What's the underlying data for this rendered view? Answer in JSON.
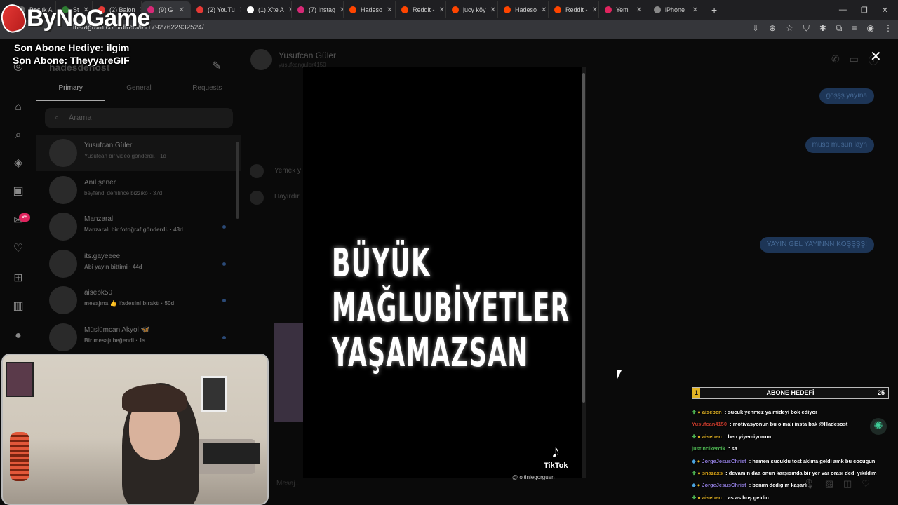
{
  "browser": {
    "tabs": [
      {
        "title": "Başlık A",
        "color": "#666"
      },
      {
        "title": "St",
        "color": "#2e7d32"
      },
      {
        "title": "(2) Balon",
        "color": "#e53935"
      },
      {
        "title": "(9) G",
        "color": "#d62976"
      },
      {
        "title": "(2) YouTu",
        "color": "#e53935"
      },
      {
        "title": "(1) X'te A",
        "color": "#ffffff"
      },
      {
        "title": "(7) Instag",
        "color": "#d62976"
      },
      {
        "title": "Hadeso",
        "color": "#ff4500"
      },
      {
        "title": "Reddit -",
        "color": "#ff4500"
      },
      {
        "title": "jucy köy",
        "color": "#ff4500"
      },
      {
        "title": "Hadeso",
        "color": "#ff4500"
      },
      {
        "title": "Reddit -",
        "color": "#ff4500"
      },
      {
        "title": "Yem",
        "color": "#e0245e"
      },
      {
        "title": "iPhone",
        "color": "#888"
      }
    ],
    "new_tab": "+",
    "url": "instagram.com/direct/t/117927622932524/"
  },
  "logo": {
    "text": "ByNoGame"
  },
  "overlay": {
    "line1": "Son Abone Hediye: ilgim",
    "line2": "Son Abone: TheyyareGIF"
  },
  "rail": {
    "notif_badge": "9+"
  },
  "dm": {
    "username": "hadesdenost",
    "tabs": [
      "Primary",
      "General",
      "Requests"
    ],
    "search_placeholder": "Arama",
    "conversations": [
      {
        "name": "Yusufcan Güler",
        "preview": "Yusufcan bir video gönderdi. · 1d",
        "bold": false
      },
      {
        "name": "Anıl şener",
        "preview": "beyfendi denilince bizziko · 37d",
        "bold": false
      },
      {
        "name": "Manzaralı",
        "preview": "Manzaralı bir fotoğraf gönderdi. · 43d",
        "bold": true
      },
      {
        "name": "its.gayeeee",
        "preview": "Abi yayın bittimi · 44d",
        "bold": true
      },
      {
        "name": "aisebk50",
        "preview": "mesajına 👍 ifadesini bıraktı · 50d",
        "bold": true
      },
      {
        "name": "Müslümcan Akyol 🦋",
        "preview": "Bir mesajı beğendi · 1s",
        "bold": true
      }
    ]
  },
  "chat": {
    "name": "Yusufcan Güler",
    "handle": "yusufcanguler4150",
    "messages_right": [
      "goşşş yayına",
      "müso musun layn",
      "YAYIN GEL YAYINNN KOŞŞŞŞ!"
    ],
    "messages_left": [
      "Yemek y",
      "Hayırdır"
    ],
    "input_placeholder": "Mesaj..."
  },
  "video": {
    "line1": "BÜYÜK",
    "line2": "MAĞLUBİYETLER",
    "line3": "YAŞAMAZSAN",
    "tiktok": "TikTok",
    "handle": "@ oltiniegorguen"
  },
  "sub_goal": {
    "label": "ABONE HEDEFİ",
    "current": "1",
    "target": "25",
    "progress": 0.04,
    "color": "#e2b324"
  },
  "stream_chat": [
    {
      "user": "aiseben",
      "text": "sucuk yenmez ya mideyi bok ediyor",
      "color": "#e2b324"
    },
    {
      "user": "Yusufcan4150",
      "text": "motivasyonun bu olmalı insta bak @Hadesost",
      "color": "#c0392b"
    },
    {
      "user": "aiseben",
      "text": "ben yiyemiyorum",
      "color": "#e2b324"
    },
    {
      "user": "justincikercik",
      "text": "sa",
      "color": "#4caf50"
    },
    {
      "user": "JorgeJesusChrist",
      "text": "hemen sucuklu tost aklına geldi amk bu cocugun",
      "color": "#8e7bd9"
    },
    {
      "user": "snazaxs",
      "text": "devamın daa onun karşısında bir yer var orası dedi yıkıldım",
      "color": "#d4a017"
    },
    {
      "user": "JorgeJesusChrist",
      "text": "benım dedıgım kaşarlı",
      "color": "#8e7bd9"
    },
    {
      "user": "aiseben",
      "text": "as as hoş geldin",
      "color": "#e2b324"
    }
  ]
}
